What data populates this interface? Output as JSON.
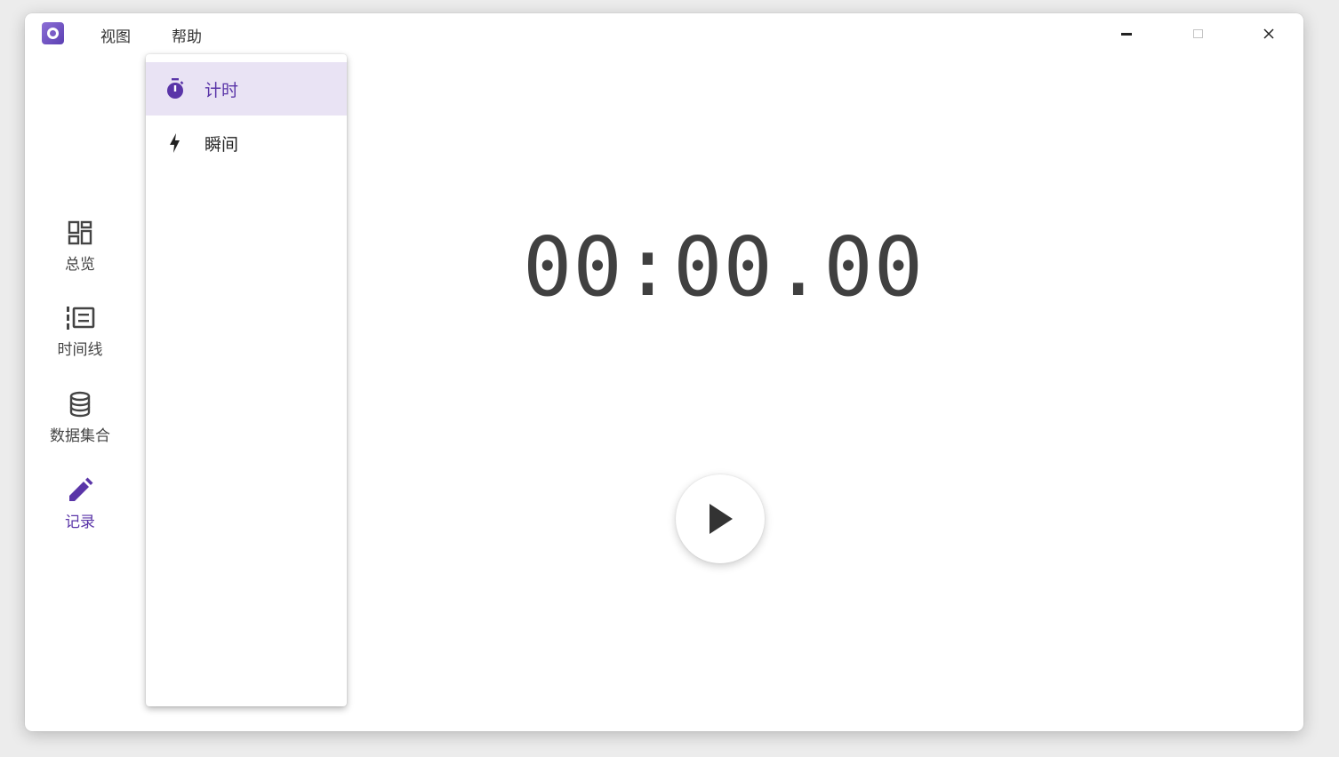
{
  "menu": {
    "view_label": "视图",
    "help_label": "帮助"
  },
  "nav": {
    "items": [
      {
        "label": "总览",
        "icon": "dashboard-icon"
      },
      {
        "label": "时间线",
        "icon": "timeline-list-icon"
      },
      {
        "label": "数据集合",
        "icon": "database-icon"
      },
      {
        "label": "记录",
        "icon": "pencil-icon"
      }
    ],
    "active": "记录"
  },
  "dropdown": {
    "items": [
      {
        "label": "计时",
        "icon": "stopwatch-icon",
        "selected": true
      },
      {
        "label": "瞬间",
        "icon": "lightning-icon",
        "selected": false
      }
    ]
  },
  "timer": {
    "display": "00:00.00"
  },
  "colors": {
    "accent": "#5a35a8",
    "selected_bg": "#e9e3f4",
    "timer_text": "#404040"
  }
}
